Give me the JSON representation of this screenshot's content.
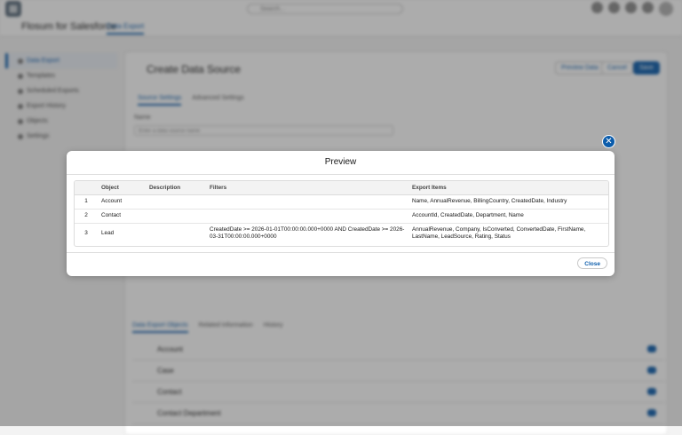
{
  "modal": {
    "title": "Preview",
    "close_icon": "close-icon",
    "close_label": "Close",
    "columns": [
      "",
      "Object",
      "Description",
      "Filters",
      "Export Items"
    ],
    "rows": [
      {
        "num": "1",
        "object": "Account",
        "description": "",
        "filters": "",
        "export_items": "Name, AnnualRevenue, BillingCountry, CreatedDate, Industry"
      },
      {
        "num": "2",
        "object": "Contact",
        "description": "",
        "filters": "",
        "export_items": "AccountId, CreatedDate, Department, Name"
      },
      {
        "num": "3",
        "object": "Lead",
        "description": "",
        "filters": "CreatedDate >= 2026-01-01T00:00:00.000+0000 AND CreatedDate >= 2026-03-31T00:00:00.000+0000",
        "export_items": "AnnualRevenue, Company, IsConverted, ConvertedDate, FirstName, LastName, LeadSource, Rating, Status"
      }
    ]
  },
  "background": {
    "app_name": "Flosum for Salesforce",
    "nav_tab": "Data Export",
    "page_title": "Create Data Source",
    "search_placeholder": "Search...",
    "sidebar_items": [
      "Data Export",
      "Templates",
      "Scheduled Exports",
      "Export History",
      "Objects",
      "Settings"
    ],
    "buttons": {
      "primary": "Save",
      "secondary": "Cancel",
      "tertiary": "Preview Data"
    },
    "tabs": [
      "Source Settings",
      "Advanced Settings"
    ],
    "field_label": "Name",
    "field_placeholder": "Enter a data source name",
    "bottom_tabs": [
      "Data Export Objects",
      "Related Information",
      "History"
    ],
    "object_rows": [
      "Account",
      "Case",
      "Contact",
      "Contact Department"
    ]
  },
  "colors": {
    "brand": "#0b5cab",
    "overlay": "rgba(48,48,48,0.40)"
  }
}
